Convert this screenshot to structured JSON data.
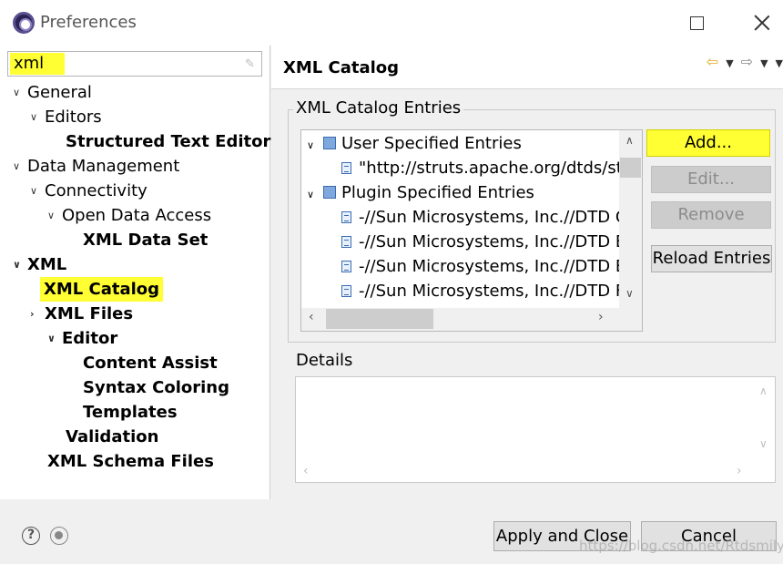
{
  "window": {
    "title": "Preferences"
  },
  "filter": {
    "value": "xml"
  },
  "tree": [
    {
      "label": "General",
      "chevron": "v",
      "bold": false
    },
    {
      "label": "Editors",
      "chevron": "v",
      "bold": false
    },
    {
      "label": "Structured Text Editors",
      "chevron": "",
      "bold": true
    },
    {
      "label": "Data Management",
      "chevron": "v",
      "bold": false
    },
    {
      "label": "Connectivity",
      "chevron": "v",
      "bold": false
    },
    {
      "label": "Open Data Access",
      "chevron": "v",
      "bold": false
    },
    {
      "label": "XML Data Set",
      "chevron": "",
      "bold": true
    },
    {
      "label": "XML",
      "chevron": "v",
      "bold": true
    },
    {
      "label": "XML Catalog",
      "chevron": "",
      "bold": true,
      "selected": true
    },
    {
      "label": "XML Files",
      "chevron": ">",
      "bold": true
    },
    {
      "label": "Editor",
      "chevron": "v",
      "bold": true
    },
    {
      "label": "Content Assist",
      "chevron": "",
      "bold": true
    },
    {
      "label": "Syntax Coloring",
      "chevron": "",
      "bold": true
    },
    {
      "label": "Templates",
      "chevron": "",
      "bold": true
    },
    {
      "label": "Validation",
      "chevron": "",
      "bold": true
    },
    {
      "label": "XML Schema Files",
      "chevron": "",
      "bold": true
    }
  ],
  "page": {
    "title": "XML Catalog"
  },
  "catalog": {
    "group_label": "XML Catalog Entries",
    "entries": [
      {
        "label": "User Specified Entries",
        "type": "group"
      },
      {
        "label": "\"http://struts.apache.org/dtds/st",
        "type": "file"
      },
      {
        "label": "Plugin Specified Entries",
        "type": "group"
      },
      {
        "label": "-//Sun Microsystems, Inc.//DTD C",
        "type": "file"
      },
      {
        "label": "-//Sun Microsystems, Inc.//DTD E",
        "type": "file"
      },
      {
        "label": "-//Sun Microsystems, Inc.//DTD E",
        "type": "file"
      },
      {
        "label": "-//Sun Microsystems, Inc.//DTD F",
        "type": "file"
      }
    ]
  },
  "buttons": {
    "add": "Add...",
    "edit": "Edit...",
    "remove": "Remove",
    "reload": "Reload Entries",
    "apply_close": "Apply and Close",
    "cancel": "Cancel"
  },
  "details": {
    "group_label": "Details"
  },
  "watermark": "https://blog.csdn.net/Rtdsmily",
  "colors": {
    "highlight": "#ffff33",
    "selection_text": "#000000"
  }
}
